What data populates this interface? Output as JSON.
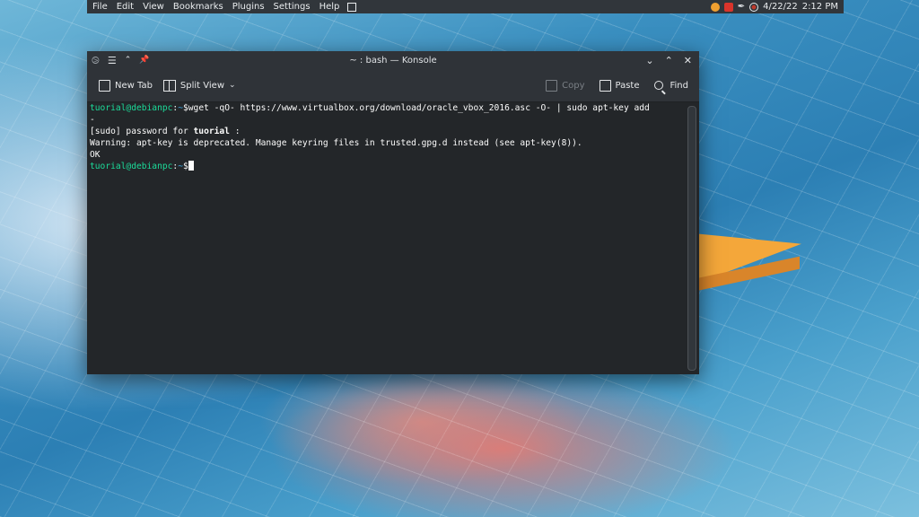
{
  "panel": {
    "menu": [
      "File",
      "Edit",
      "View",
      "Bookmarks",
      "Plugins",
      "Settings",
      "Help"
    ],
    "date": "4/22/22",
    "time": "2:12 PM"
  },
  "window": {
    "title": "~ : bash — Konsole",
    "toolbar": {
      "new_tab": "New Tab",
      "split_view": "Split View",
      "copy": "Copy",
      "paste": "Paste",
      "find": "Find"
    }
  },
  "terminal": {
    "line1": {
      "user_host": "tuorial@debianpc",
      "sep": ":",
      "path": "~",
      "dollar": "$",
      "command": "wget -qO- https://www.virtualbox.org/download/oracle_vbox_2016.asc -O- | sudo apt-key add"
    },
    "line1_wrap": "-",
    "line2_prefix": "[sudo] password for ",
    "line2_user": "tuorial",
    "line2_suffix": " :",
    "line3": "Warning: apt-key is deprecated. Manage keyring files in trusted.gpg.d instead (see apt-key(8)).",
    "line4": "OK",
    "line5": {
      "user_host": "tuorial@debianpc",
      "sep": ":",
      "path": "~",
      "dollar": "$"
    }
  },
  "colors": {
    "panel_bg": "#31363b",
    "terminal_bg": "#232629",
    "prompt_user": "#1cdc9a",
    "prompt_path": "#3daee9"
  }
}
